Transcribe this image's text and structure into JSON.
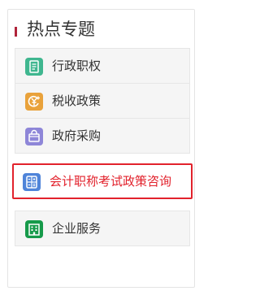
{
  "panel": {
    "title": "热点专题",
    "accent_color": "#b0243a",
    "items": [
      {
        "label": "行政职权",
        "icon": "document-icon",
        "icon_color": "#3fb68f",
        "active": false
      },
      {
        "label": "税收政策",
        "icon": "yen-tax-icon",
        "icon_color": "#e9a23b",
        "active": false
      },
      {
        "label": "政府采购",
        "icon": "shopping-bag-icon",
        "icon_color": "#8e86d8",
        "active": false
      },
      {
        "label": "会计职称考试政策咨询",
        "icon": "calculator-icon",
        "icon_color": "#4f84d9",
        "active": true
      },
      {
        "label": "企业服务",
        "icon": "building-icon",
        "icon_color": "#169a4a",
        "active": false
      }
    ],
    "active_color": "#e2222c"
  }
}
